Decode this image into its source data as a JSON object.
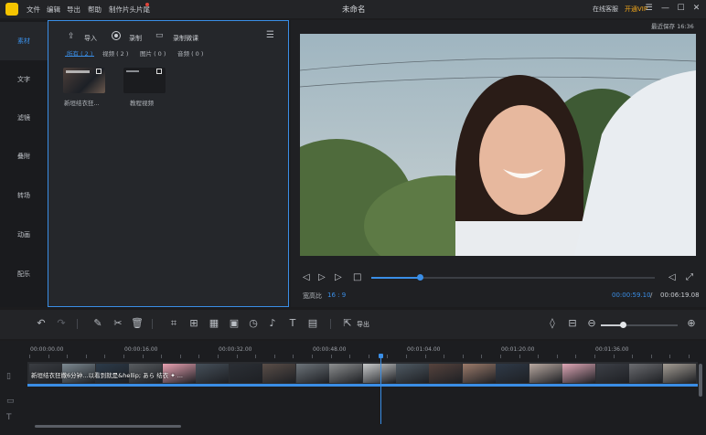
{
  "app": {
    "logo_glyph": "",
    "document_title": "未命名",
    "menu": [
      "文件",
      "编辑",
      "导出",
      "帮助",
      "制作片头片尾"
    ],
    "online_service": "在线客服",
    "vip": "开通VIP",
    "autosave": "最近保存 16:36",
    "window_controls": [
      "menu-icon",
      "minimize-icon",
      "maximize-icon",
      "close-icon"
    ]
  },
  "sidebar": {
    "items": [
      {
        "label": "素材",
        "active": true
      },
      {
        "label": "文字",
        "active": false
      },
      {
        "label": "滤镜",
        "active": false
      },
      {
        "label": "叠附",
        "active": false
      },
      {
        "label": "转场",
        "active": false
      },
      {
        "label": "动画",
        "active": false
      },
      {
        "label": "配乐",
        "active": false
      }
    ]
  },
  "library": {
    "import_label": "导入",
    "record_label": "录制",
    "microlesson_label": "录制微课",
    "filters": [
      "所有 ( 2 )",
      "视频 ( 2 )",
      "图片 ( 0 )",
      "音频 ( 0 )"
    ],
    "active_filter": 0,
    "items": [
      {
        "label": "新垣结衣狂...",
        "type": "video"
      },
      {
        "label": "教程视频",
        "type": "video"
      }
    ]
  },
  "preview": {
    "watermark": "",
    "aspect_label": "宽高比",
    "aspect_value": "16 : 9",
    "current_time": "00:00:59.10",
    "separator": "/",
    "total_time": "00:06:19.08",
    "progress": 0.17
  },
  "toolbar": {
    "export_label": "导出",
    "zoom_level": 0.28
  },
  "timeline": {
    "ruler": [
      "00:00:00.00",
      "00:00:16.00",
      "00:00:32.00",
      "00:00:48.00",
      "00:01:04.00",
      "00:01:20.00",
      "00:01:36.00"
    ],
    "clip_title": "新垣结衣狂撒6分钟…以看到就是&hellip; あら 结衣 ✦ ...",
    "frame_colors": [
      "#3a3d42",
      "#7d8a92",
      "#2c3b4a",
      "#585c60",
      "#e9a2b2",
      "#46505a",
      "#2b2f35",
      "#5a4e48",
      "#6d747a",
      "#8d8f90",
      "#c7c9ca",
      "#4f5a63",
      "#56433d",
      "#9c7b6a",
      "#2f3a48",
      "#b9a9a1",
      "#dfa7b6",
      "#3d4047",
      "#6b6c70",
      "#a49d94"
    ]
  },
  "colors": {
    "accent": "#3a8ee6",
    "vip": "#f2a71b",
    "logo": "#f5c400"
  }
}
